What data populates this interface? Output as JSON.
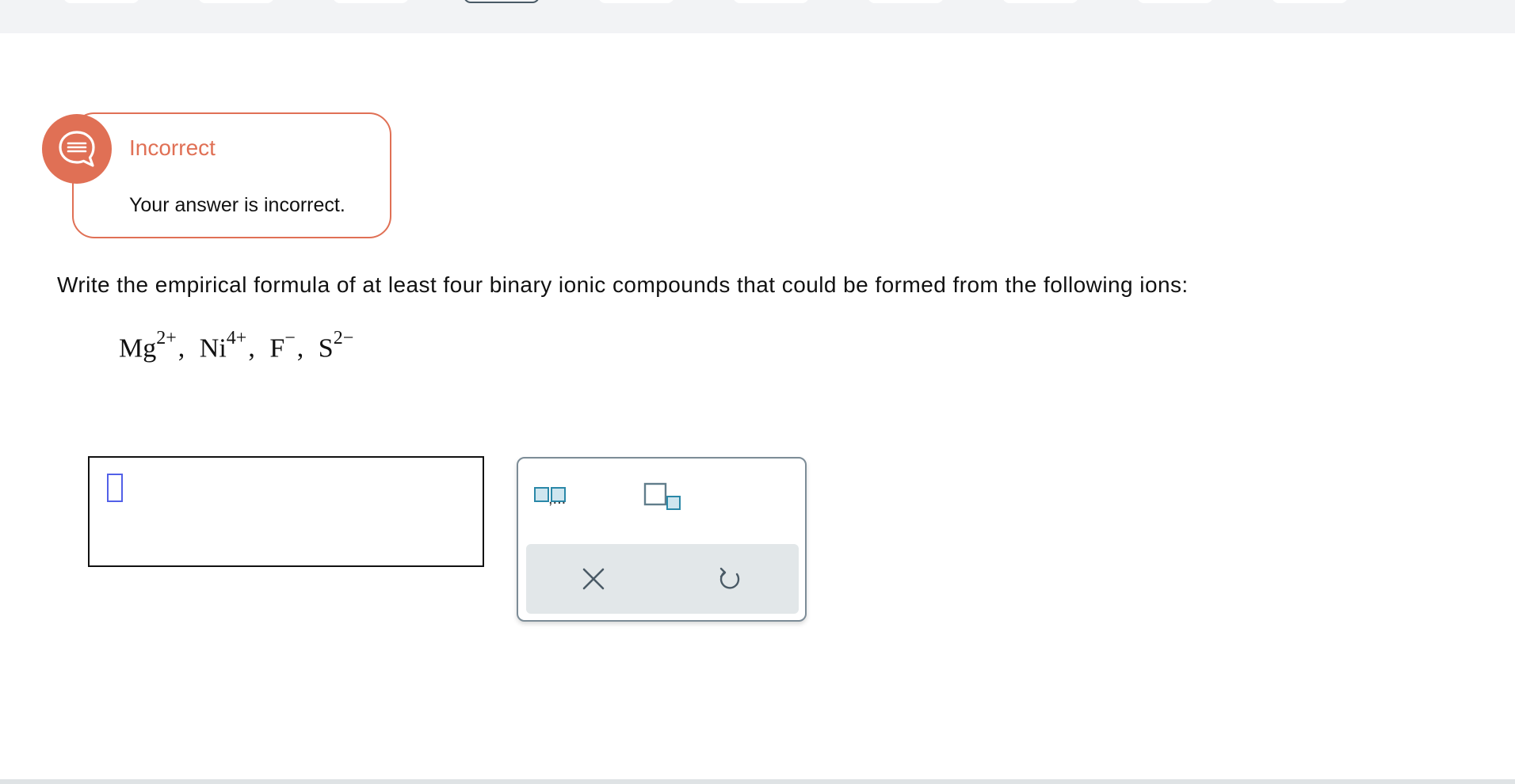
{
  "feedback": {
    "status_title": "Incorrect",
    "message": "Your answer is incorrect.",
    "color": "#e07055",
    "icon": "speech-bubble-icon"
  },
  "question": {
    "prompt": "Write the empirical formula of at least four binary ionic compounds that could be formed from the following ions:",
    "ions": [
      {
        "symbol": "Mg",
        "charge": "2+"
      },
      {
        "symbol": "Ni",
        "charge": "4+"
      },
      {
        "symbol": "F",
        "charge": "−"
      },
      {
        "symbol": "S",
        "charge": "2−"
      }
    ],
    "separator": ","
  },
  "answer": {
    "value": ""
  },
  "palette": {
    "list_template_icon": "list-template-icon",
    "subscript_template_icon": "subscript-template-icon",
    "list_template_label": ",...",
    "clear_icon": "close-icon",
    "undo_icon": "undo-icon"
  },
  "colors": {
    "accent": "#e07055",
    "cursor": "#5260e8",
    "template_fill": "#cfe6ef",
    "template_stroke": "#2a88a8",
    "palette_border": "#7c8c97",
    "action_bar": "#e2e7e9"
  }
}
